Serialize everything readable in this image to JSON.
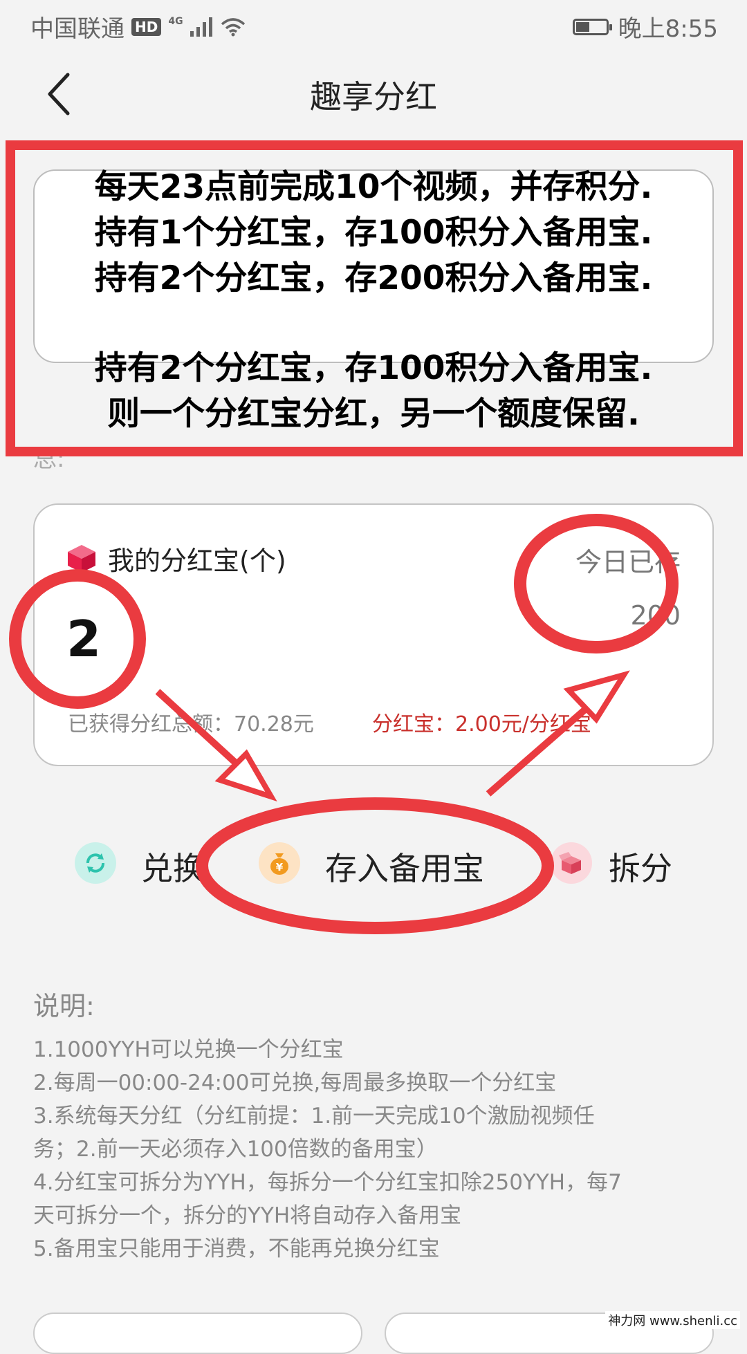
{
  "status_bar": {
    "carrier": "中国联通",
    "hd": "HD",
    "network": "4G",
    "time": "晚上8:55",
    "battery_level": 0.45
  },
  "header": {
    "title": "趣享分红"
  },
  "notice": {
    "lines": [
      "每天23点前完成10个视频，并存积分.",
      "持有1个分红宝，存100积分入备用宝.",
      "持有2个分红宝，存200积分入备用宝.",
      "持有2个分红宝，存100积分入备用宝.",
      "则一个分红宝分红，另一个额度保留."
    ],
    "partial": "总:"
  },
  "card": {
    "title": "我的分红宝(个)",
    "count": "2",
    "today_label": "今日已存",
    "today_value": "200",
    "total_label": "已获得分红总额：70.28元",
    "rate_label": "分红宝：2.00元/分红宝"
  },
  "actions": {
    "exchange": "兑换",
    "deposit": "存入备用宝",
    "split": "拆分"
  },
  "description": {
    "title": "说明:",
    "items": [
      "1.1000YYH可以兑换一个分红宝",
      "2.每周一00:00-24:00可兑换,每周最多换取一个分红宝",
      "3.系统每天分红（分红前提：1.前一天完成10个激励视频任",
      "务；2.前一天必须存入100倍数的备用宝）",
      "4.分红宝可拆分为YYH，每拆分一个分红宝扣除250YYH，每7",
      "天可拆分一个，拆分的YYH将自动存入备用宝",
      "5.备用宝只能用于消费，不能再兑换分红宝"
    ]
  },
  "watermark": "神力网 www.shenli.cc",
  "colors": {
    "annotation_red": "#ea3b40",
    "rate_red": "#c9302c",
    "background": "#f3f3f3"
  }
}
